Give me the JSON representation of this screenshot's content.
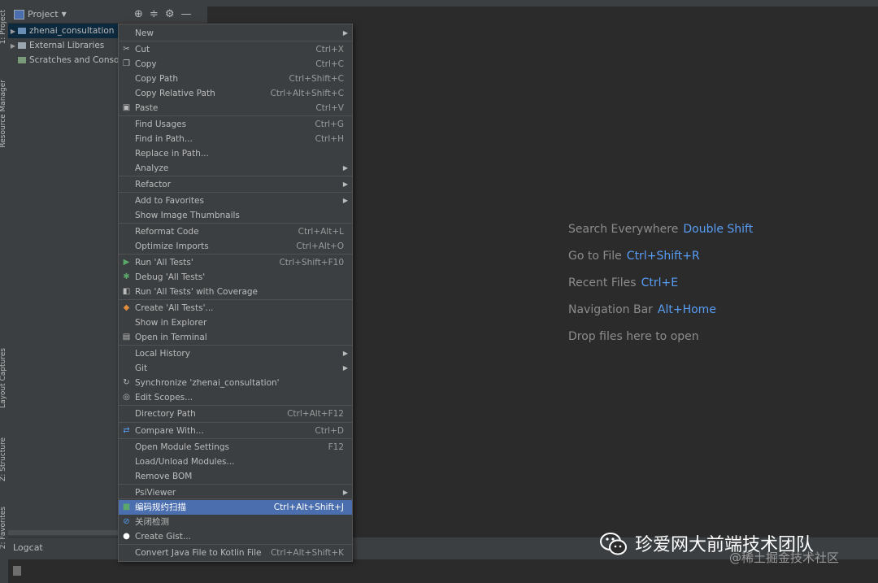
{
  "left_strip": {
    "tabs": [
      "1: Project",
      "Resource Manager",
      "Layout Captures",
      "Z: Structure",
      "2: Favorites"
    ]
  },
  "project_panel": {
    "title": "Project",
    "tree": [
      {
        "label": "zhenai_consultation",
        "expandable": true,
        "selected": true
      },
      {
        "label": "External Libraries",
        "expandable": true,
        "selected": false
      },
      {
        "label": "Scratches and Consoles",
        "expandable": false,
        "selected": false
      }
    ]
  },
  "context_menu": {
    "items": [
      {
        "label": "New",
        "shortcut": "",
        "submenu": true,
        "icon": ""
      },
      {
        "label": "Cut",
        "shortcut": "Ctrl+X",
        "submenu": false,
        "icon": "scissors-icon"
      },
      {
        "label": "Copy",
        "shortcut": "Ctrl+C",
        "submenu": false,
        "icon": "copy-icon"
      },
      {
        "label": "Copy Path",
        "shortcut": "Ctrl+Shift+C",
        "submenu": false,
        "icon": ""
      },
      {
        "label": "Copy Relative Path",
        "shortcut": "Ctrl+Alt+Shift+C",
        "submenu": false,
        "icon": ""
      },
      {
        "label": "Paste",
        "shortcut": "Ctrl+V",
        "submenu": false,
        "icon": "paste-icon"
      },
      {
        "label": "Find Usages",
        "shortcut": "Ctrl+G",
        "submenu": false,
        "icon": ""
      },
      {
        "label": "Find in Path...",
        "shortcut": "Ctrl+H",
        "submenu": false,
        "icon": ""
      },
      {
        "label": "Replace in Path...",
        "shortcut": "",
        "submenu": false,
        "icon": ""
      },
      {
        "label": "Analyze",
        "shortcut": "",
        "submenu": true,
        "icon": ""
      },
      {
        "label": "Refactor",
        "shortcut": "",
        "submenu": true,
        "icon": ""
      },
      {
        "label": "Add to Favorites",
        "shortcut": "",
        "submenu": true,
        "icon": ""
      },
      {
        "label": "Show Image Thumbnails",
        "shortcut": "",
        "submenu": false,
        "icon": ""
      },
      {
        "label": "Reformat Code",
        "shortcut": "Ctrl+Alt+L",
        "submenu": false,
        "icon": ""
      },
      {
        "label": "Optimize Imports",
        "shortcut": "Ctrl+Alt+O",
        "submenu": false,
        "icon": ""
      },
      {
        "label": "Run 'All Tests'",
        "shortcut": "Ctrl+Shift+F10",
        "submenu": false,
        "icon": "run-icon"
      },
      {
        "label": "Debug 'All Tests'",
        "shortcut": "",
        "submenu": false,
        "icon": "debug-icon"
      },
      {
        "label": "Run 'All Tests' with Coverage",
        "shortcut": "",
        "submenu": false,
        "icon": "coverage-icon"
      },
      {
        "label": "Create 'All Tests'...",
        "shortcut": "",
        "submenu": false,
        "icon": "create-test-icon"
      },
      {
        "label": "Show in Explorer",
        "shortcut": "",
        "submenu": false,
        "icon": ""
      },
      {
        "label": "Open in Terminal",
        "shortcut": "",
        "submenu": false,
        "icon": "terminal-icon"
      },
      {
        "label": "Local History",
        "shortcut": "",
        "submenu": true,
        "icon": ""
      },
      {
        "label": "Git",
        "shortcut": "",
        "submenu": true,
        "icon": ""
      },
      {
        "label": "Synchronize 'zhenai_consultation'",
        "shortcut": "",
        "submenu": false,
        "icon": "sync-icon"
      },
      {
        "label": "Edit Scopes...",
        "shortcut": "",
        "submenu": false,
        "icon": "scopes-icon"
      },
      {
        "label": "Directory Path",
        "shortcut": "Ctrl+Alt+F12",
        "submenu": false,
        "icon": ""
      },
      {
        "label": "Compare With...",
        "shortcut": "Ctrl+D",
        "submenu": false,
        "icon": "compare-icon"
      },
      {
        "label": "Open Module Settings",
        "shortcut": "F12",
        "submenu": false,
        "icon": ""
      },
      {
        "label": "Load/Unload Modules...",
        "shortcut": "",
        "submenu": false,
        "icon": ""
      },
      {
        "label": "Remove BOM",
        "shortcut": "",
        "submenu": false,
        "icon": ""
      },
      {
        "label": "PsiViewer",
        "shortcut": "",
        "submenu": true,
        "icon": ""
      },
      {
        "label": "编码规约扫描",
        "shortcut": "Ctrl+Alt+Shift+J",
        "submenu": false,
        "icon": "scan-icon",
        "highlighted": true
      },
      {
        "label": "关闭检测",
        "shortcut": "",
        "submenu": false,
        "icon": "disable-icon"
      },
      {
        "label": "Create Gist...",
        "shortcut": "",
        "submenu": false,
        "icon": "github-icon"
      },
      {
        "label": "Convert Java File to Kotlin File",
        "shortcut": "Ctrl+Alt+Shift+K",
        "submenu": false,
        "icon": ""
      }
    ]
  },
  "welcome": {
    "hints": [
      {
        "text": "Search Everywhere",
        "key": "Double Shift"
      },
      {
        "text": "Go to File",
        "key": "Ctrl+Shift+R"
      },
      {
        "text": "Recent Files",
        "key": "Ctrl+E"
      },
      {
        "text": "Navigation Bar",
        "key": "Alt+Home"
      },
      {
        "text": "Drop files here to open",
        "key": ""
      }
    ]
  },
  "bottom": {
    "logcat_label": "Logcat"
  },
  "watermark": {
    "title": "珍爱网大前端技术团队",
    "subtitle": "@稀土掘金技术社区"
  },
  "colors": {
    "accent": "#589df6",
    "selection": "#4b6eaf",
    "panel": "#3c3f41",
    "editor": "#2b2b2b"
  }
}
